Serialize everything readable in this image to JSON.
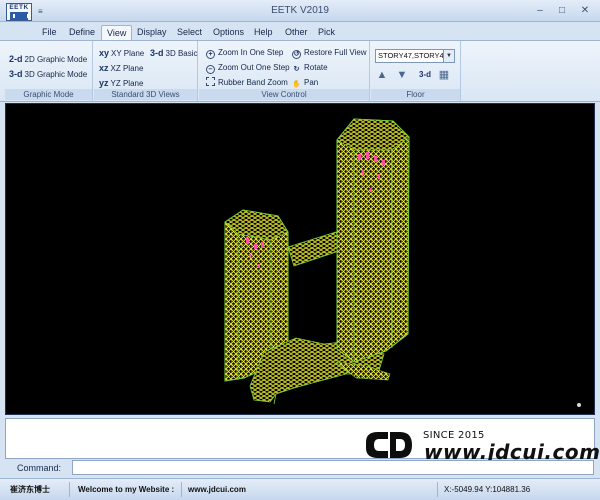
{
  "window": {
    "title": "EETK V2019",
    "logo_text": "EETK",
    "qat_glyph": "≡",
    "controls": {
      "minimize": "–",
      "maximize": "□",
      "close": "✕"
    }
  },
  "menu": {
    "tabs": [
      "File",
      "Define",
      "View",
      "Display",
      "Select",
      "Options",
      "Help",
      "Other",
      "Pick"
    ],
    "active": "View",
    "help_glyph": "?"
  },
  "ribbon": {
    "groups": {
      "graphic_mode": {
        "label": "Graphic Mode",
        "buttons": [
          {
            "icon": "2-d",
            "label": "2D Graphic Mode"
          },
          {
            "icon": "3-d",
            "label": "3D Graphic Mode"
          }
        ]
      },
      "standard_3d_views": {
        "label": "Standard 3D Views",
        "buttons": [
          {
            "icon": "xy",
            "label": "XY Plane"
          },
          {
            "icon": "3-d",
            "label": "3D Basic"
          },
          {
            "icon": "xz",
            "label": "XZ Plane"
          },
          {
            "icon": "yz",
            "label": "YZ Plane"
          }
        ]
      },
      "view_control": {
        "label": "View Control",
        "buttons": [
          {
            "icon": "+",
            "label": "Zoom In One Step"
          },
          {
            "icon": "↺",
            "label": "Restore Full View"
          },
          {
            "icon": "–",
            "label": "Zoom Out One Step"
          },
          {
            "icon": "↻",
            "label": "Rotate"
          },
          {
            "icon": "",
            "label": "Rubber Band Zoom"
          },
          {
            "icon": "✋",
            "label": "Pan"
          }
        ]
      },
      "floor": {
        "label": "Floor",
        "story_value": "STORY47,STORY4",
        "drop_glyph": "▼",
        "up_icon": "▲",
        "down_icon": "▼",
        "view3d_label": "3-d",
        "grid_icon": "▦"
      }
    }
  },
  "viewport": {
    "colors": {
      "background": "#000000",
      "wireframe": "#f4f23a",
      "bracing": "#ff4fa3",
      "outline": "#7ad23c"
    }
  },
  "output": {
    "watermark_since": "SINCE 2015",
    "watermark_url": "www.jdcui.com",
    "watermark_logo": "CD"
  },
  "command": {
    "label": "Command:",
    "value": ""
  },
  "status": {
    "user": "崔济东博士",
    "welcome": "Welcome to my Website :",
    "url": "www.jdcui.com",
    "coords": "X:-5049.94 Y:104881.36"
  }
}
